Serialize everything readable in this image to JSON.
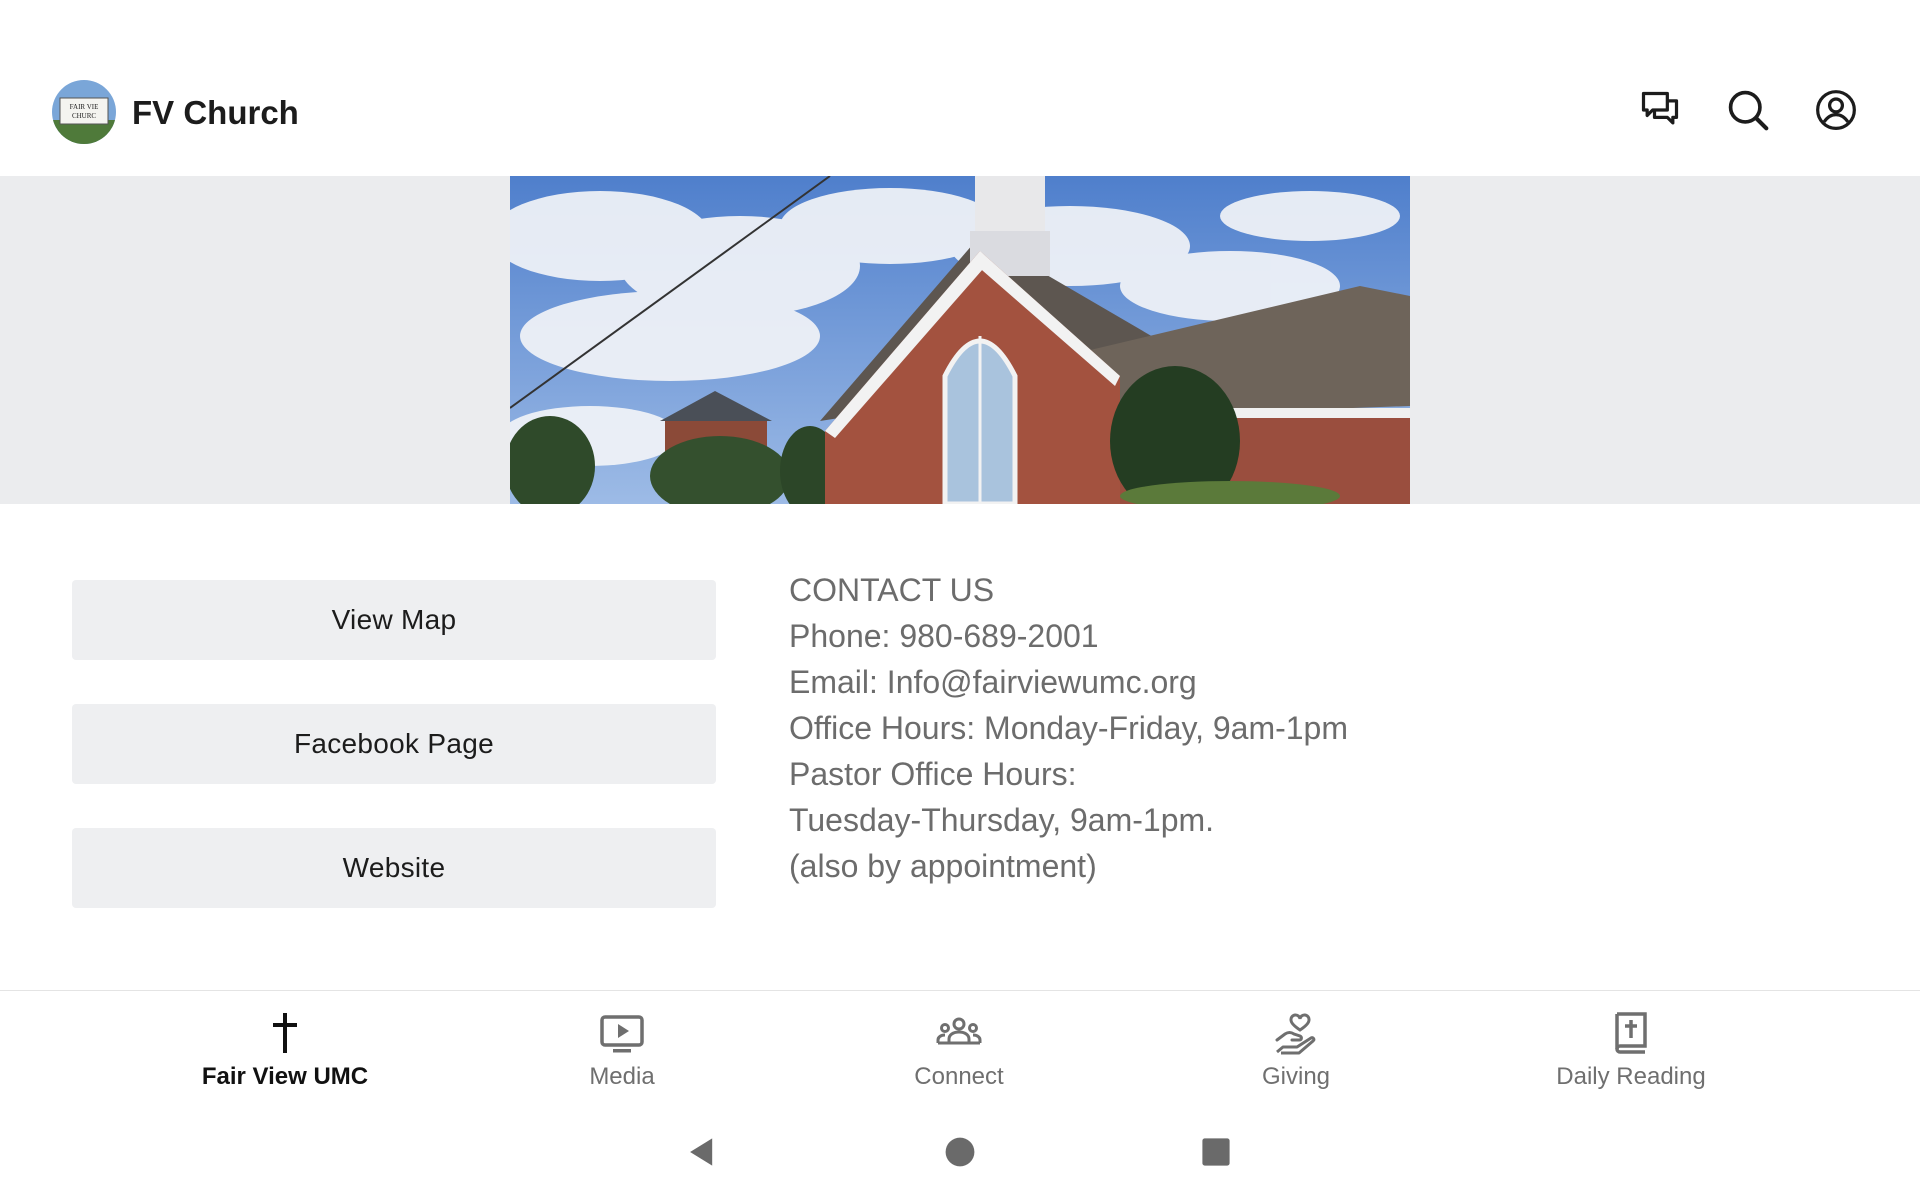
{
  "header": {
    "title": "FV Church",
    "logo_text_line1": "FAIR VIE",
    "logo_text_line2": "CHURC",
    "icons": [
      "chat-icon",
      "search-icon",
      "account-icon"
    ]
  },
  "banner": {
    "image": "church-building-photo"
  },
  "buttons": [
    {
      "label": "View Map"
    },
    {
      "label": "Facebook Page"
    },
    {
      "label": "Website"
    }
  ],
  "contact": {
    "heading": "CONTACT US",
    "lines": [
      "Phone: 980-689-2001",
      "Email: Info@fairviewumc.org",
      "Office Hours: Monday-Friday, 9am-1pm",
      "Pastor Office Hours:",
      "Tuesday-Thursday, 9am-1pm.",
      "(also by appointment)"
    ]
  },
  "bottom_nav": {
    "active_index": 0,
    "items": [
      {
        "label": "Fair View UMC",
        "icon": "cross-icon"
      },
      {
        "label": "Media",
        "icon": "media-icon"
      },
      {
        "label": "Connect",
        "icon": "people-icon"
      },
      {
        "label": "Giving",
        "icon": "giving-icon"
      },
      {
        "label": "Daily Reading",
        "icon": "bible-icon"
      }
    ]
  },
  "system_nav": [
    "back-icon",
    "home-icon",
    "recents-icon"
  ],
  "colors": {
    "banner_bg": "#ebecee",
    "button_bg": "#eeeff1",
    "contact_text": "#6c6c6c",
    "nav_inactive": "#6f6f6f",
    "nav_active": "#111111"
  }
}
